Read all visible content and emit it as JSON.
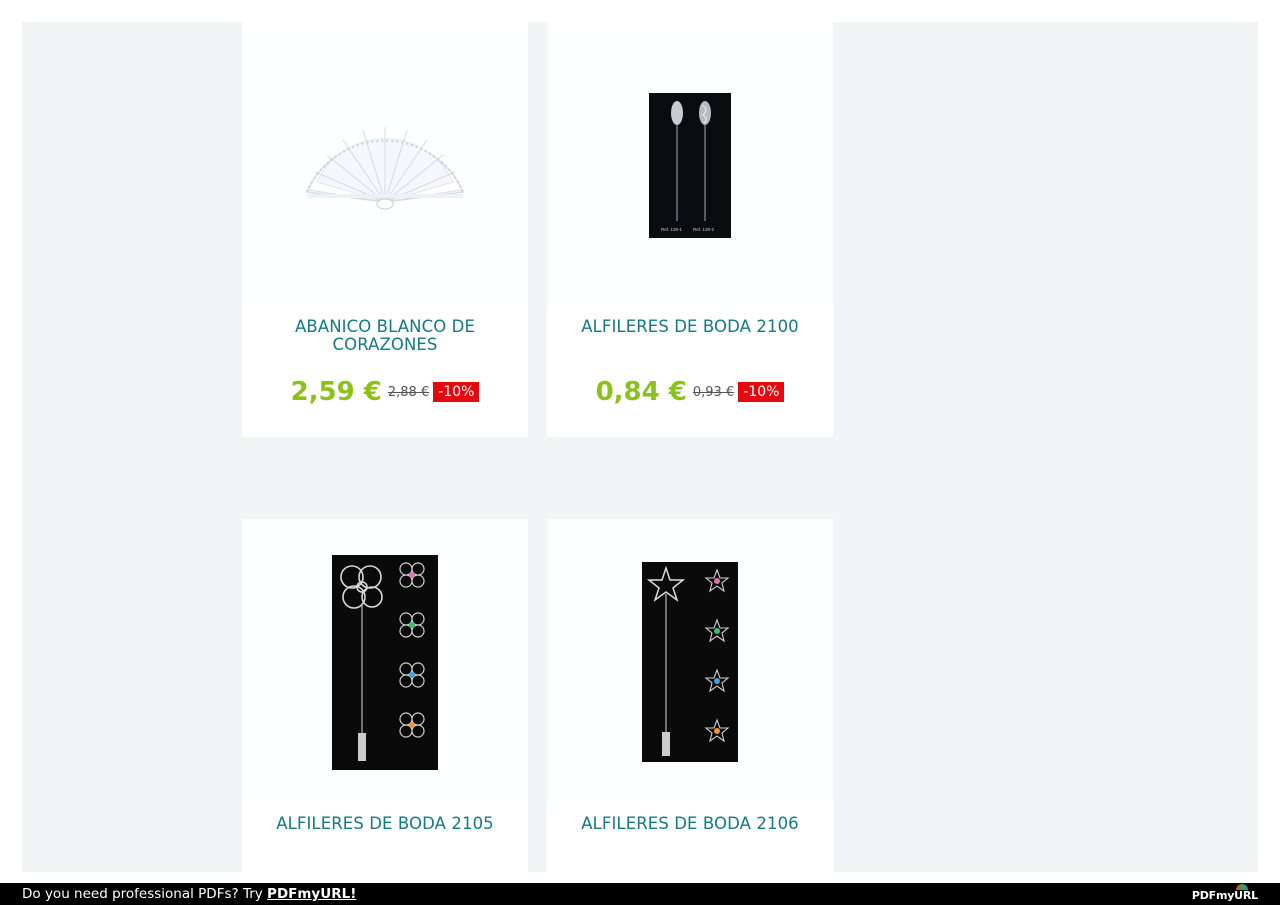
{
  "products": [
    {
      "title": "ABANICO BLANCO DE CORAZONES",
      "price": "2,59 €",
      "old_price": "2,88 €",
      "discount": "-10%",
      "image": "white-hand-fan-image"
    },
    {
      "title": "ALFILERES DE BODA 2100",
      "price": "0,84 €",
      "old_price": "0,93 €",
      "discount": "-10%",
      "image": "bridal-pins-2100-image",
      "image_caption_left": "Ref. 139-1",
      "image_caption_right": "Ref. 139-2"
    },
    {
      "title": "ALFILERES DE BODA 2105",
      "image": "flower-pins-2105-image"
    },
    {
      "title": "ALFILERES DE BODA 2106",
      "image": "star-pins-2106-image"
    }
  ],
  "footer": {
    "message": "Do you need professional PDFs? Try",
    "link_label": "PDFmyURL!",
    "logo_text": "PDFmyURL"
  },
  "colors": {
    "background": "#f1f5f5",
    "title": "#137a82",
    "price": "#8bc21a",
    "discount_bg": "#e6070f"
  }
}
